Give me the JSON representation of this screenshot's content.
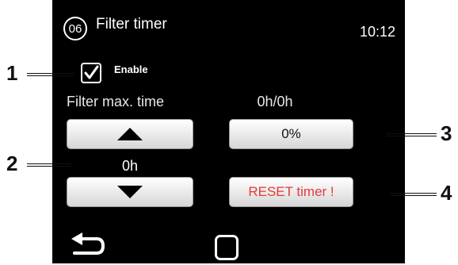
{
  "header": {
    "page_number": "06",
    "title": "Filter timer",
    "time": "10:12"
  },
  "enable": {
    "label": "Enable",
    "checked": true
  },
  "filter_max_time": {
    "label": "Filter max. time",
    "value": "0h"
  },
  "usage": {
    "ratio": "0h/0h",
    "percent_label": "0%",
    "percent": 0
  },
  "reset_button": {
    "label": "RESET timer !",
    "color": "#e53a3a"
  },
  "navigation": {
    "back": "back-arrow-icon",
    "home": "home-square-icon"
  },
  "callouts": {
    "c1": "1",
    "c2": "2",
    "c3": "3",
    "c4": "4"
  }
}
